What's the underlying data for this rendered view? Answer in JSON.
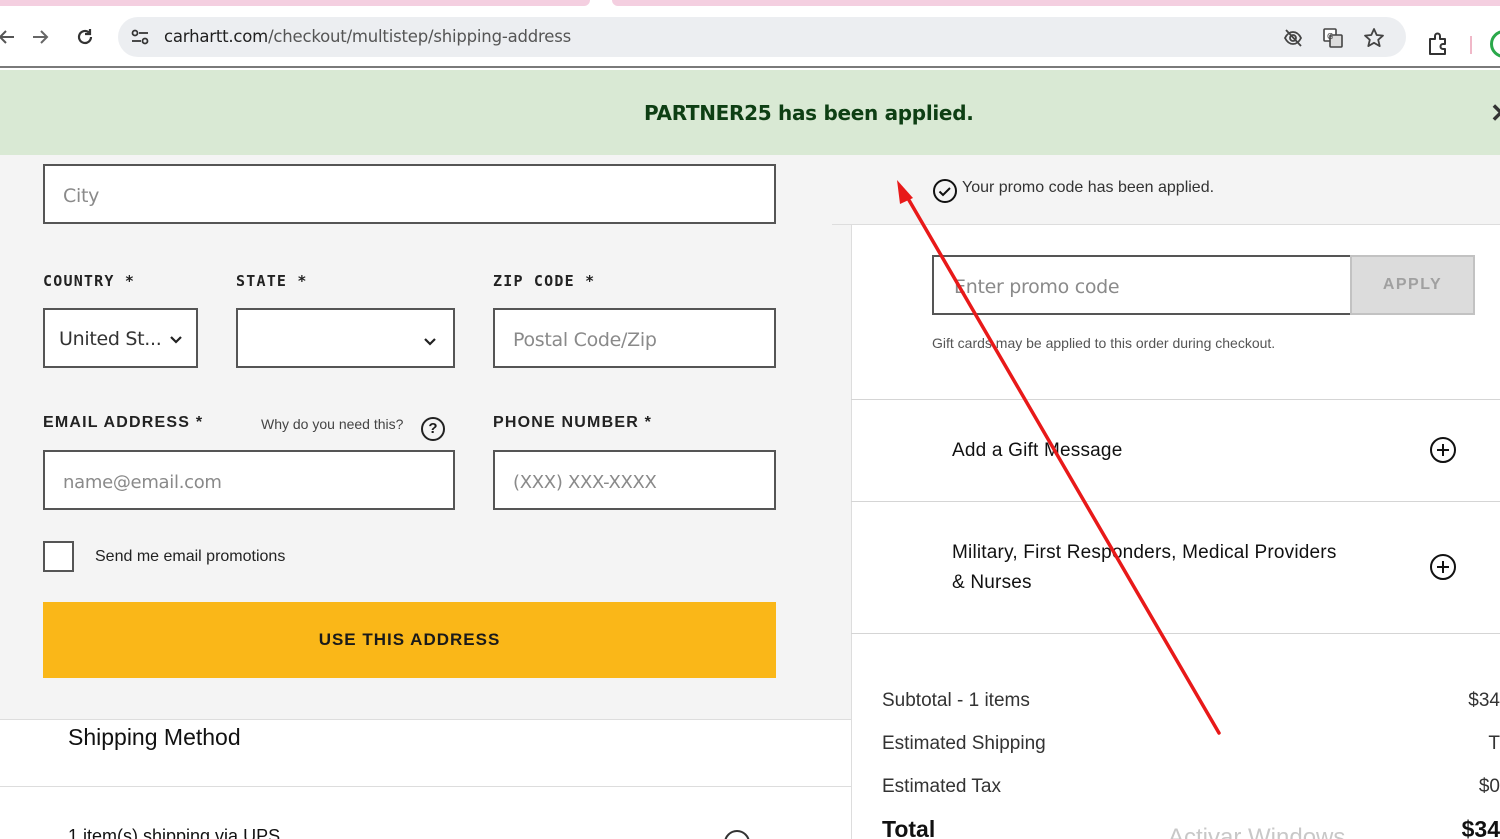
{
  "browser": {
    "url_host": "carhartt.com",
    "url_path": "/checkout/multistep/shipping-address"
  },
  "banner": {
    "message": "PARTNER25 has been applied.",
    "close_glyph": "✕"
  },
  "address_form": {
    "city_placeholder": "City",
    "country_label": "COUNTRY *",
    "country_value": "United St...",
    "state_label": "STATE *",
    "state_value": "",
    "zip_label": "ZIP CODE *",
    "zip_placeholder": "Postal Code/Zip",
    "email_label": "EMAIL ADDRESS *",
    "email_help": "Why do you need this?",
    "email_help_glyph": "?",
    "email_placeholder": "name@email.com",
    "phone_label": "PHONE NUMBER *",
    "phone_placeholder": "(XXX) XXX-XXXX",
    "email_promos_label": "Send me email promotions",
    "submit_label": "USE THIS ADDRESS"
  },
  "shipping_method": {
    "title": "Shipping Method",
    "summary": "1 item(s) shipping via UPS"
  },
  "promo": {
    "applied_text": "Your promo code has been applied.",
    "input_placeholder": "Enter promo code",
    "apply_label": "APPLY",
    "gift_card_note": "Gift cards may be applied to this order during checkout."
  },
  "accordions": {
    "gift_message": "Add a Gift Message",
    "military_line1": "Military, First Responders, Medical Providers",
    "military_line2": "& Nurses"
  },
  "summary": {
    "subtotal_label": "Subtotal - 1 items",
    "subtotal_value": "$34",
    "shipping_label": "Estimated Shipping",
    "shipping_value": "T",
    "tax_label": "Estimated Tax",
    "tax_value": "$0",
    "total_label": "Total",
    "total_value": "$34"
  },
  "watermark": "Activar Windows",
  "colors": {
    "banner_bg": "#d9e9d4",
    "banner_text": "#0e3f14",
    "success_green": "#22a447",
    "primary_button": "#fab718",
    "annotation_arrow": "#e81919"
  },
  "icons": [
    "back-arrow-icon",
    "forward-arrow-icon",
    "reload-icon",
    "site-settings-icon",
    "eye-off-icon",
    "translate-icon",
    "star-icon",
    "extensions-icon",
    "success-check-icon",
    "close-icon",
    "chevron-down-icon",
    "help-icon",
    "check-circle-icon",
    "plus-circle-icon"
  ]
}
